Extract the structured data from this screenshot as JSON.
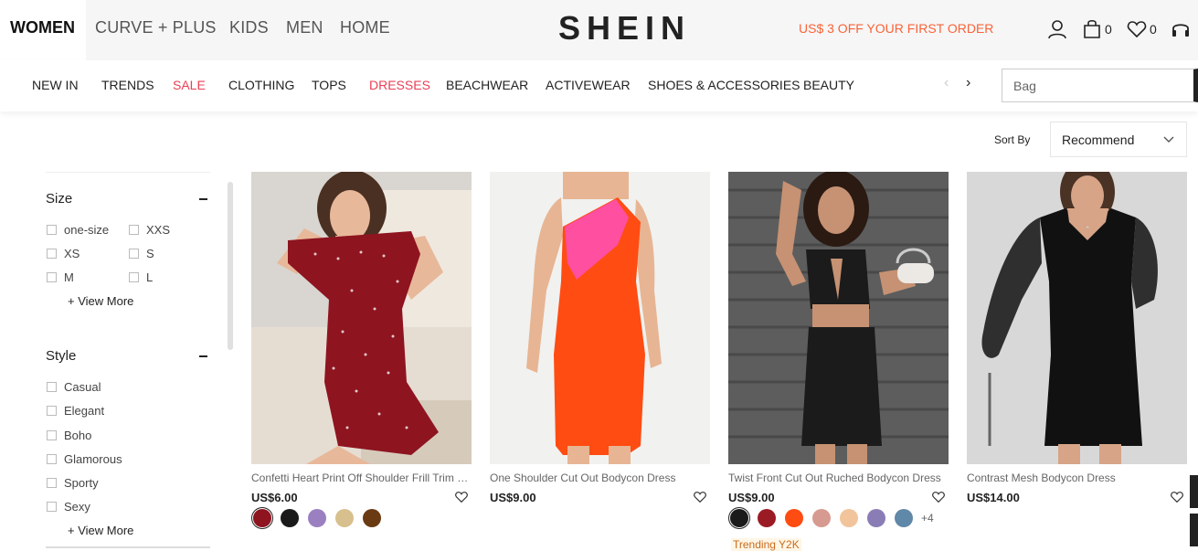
{
  "header": {
    "categories": [
      "WOMEN",
      "CURVE + PLUS",
      "KIDS",
      "MEN",
      "HOME"
    ],
    "logo": "SHEIN",
    "promo": "US$ 3 OFF YOUR FIRST ORDER",
    "bag_count": "0",
    "wishlist_count": "0",
    "icons": [
      "user-icon",
      "bag-icon",
      "heart-icon",
      "headset-icon"
    ]
  },
  "nav": {
    "items": [
      "NEW IN",
      "TRENDS",
      "SALE",
      "CLOTHING",
      "TOPS",
      "DRESSES",
      "BEACHWEAR",
      "ACTIVEWEAR",
      "SHOES & ACCESSORIES",
      "BEAUTY"
    ],
    "search_placeholder": "Bag"
  },
  "sort": {
    "label": "Sort By",
    "value": "Recommend"
  },
  "filters": {
    "size": {
      "title": "Size",
      "options": [
        "one-size",
        "XXS",
        "XS",
        "S",
        "M",
        "L"
      ],
      "view_more": "View More"
    },
    "style": {
      "title": "Style",
      "options": [
        "Casual",
        "Elegant",
        "Boho",
        "Glamorous",
        "Sporty",
        "Sexy"
      ],
      "view_more": "View More"
    }
  },
  "products": [
    {
      "name": "Confetti Heart Print Off Shoulder Frill Trim Bodycon Dress",
      "price": "US$6.00",
      "swatches": [
        "#8e1420",
        "#1a1a1a",
        "#9a80c0",
        "#d8c08e",
        "#6a3a12"
      ]
    },
    {
      "name": "One Shoulder Cut Out Bodycon Dress",
      "price": "US$9.00",
      "swatches": []
    },
    {
      "name": "Twist Front Cut Out Ruched Bodycon Dress",
      "price": "US$9.00",
      "swatches": [
        "#1a1a1a",
        "#9b1b25",
        "#ff4c12",
        "#d79a90",
        "#f2c49b",
        "#8a7db5",
        "#6088a8"
      ],
      "more": "+4",
      "badge": "Trending Y2K"
    },
    {
      "name": "Contrast Mesh Bodycon Dress",
      "price": "US$14.00",
      "swatches": []
    }
  ],
  "colors": {
    "accent_red": "#e94056",
    "promo_orange": "#fa6338",
    "dark": "#222222"
  }
}
